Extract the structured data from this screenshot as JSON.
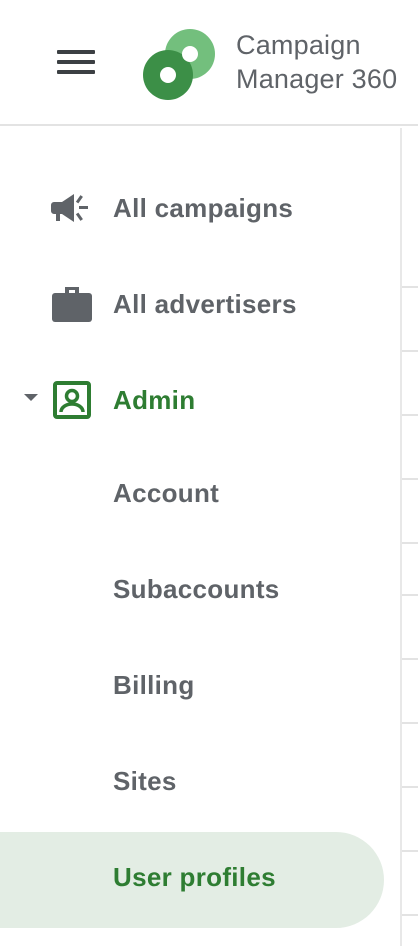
{
  "header": {
    "title_line1": "Campaign",
    "title_line2": "Manager 360",
    "menu_icon": "hamburger-menu-icon",
    "logo_icon": "campaign-manager-logo"
  },
  "colors": {
    "brand_green": "#2e7d32",
    "logo_dark": "#3c8f47",
    "logo_light": "#73bf7d",
    "active_bg": "#e3ede4",
    "text_gray": "#5f6368"
  },
  "nav": {
    "items": [
      {
        "label": "All campaigns",
        "icon": "megaphone-icon"
      },
      {
        "label": "All advertisers",
        "icon": "briefcase-icon"
      },
      {
        "label": "Admin",
        "icon": "account-box-icon",
        "expanded": true
      }
    ],
    "admin_sub_items": [
      {
        "label": "Account"
      },
      {
        "label": "Subaccounts"
      },
      {
        "label": "Billing"
      },
      {
        "label": "Sites"
      },
      {
        "label": "User profiles",
        "selected": true
      }
    ]
  }
}
